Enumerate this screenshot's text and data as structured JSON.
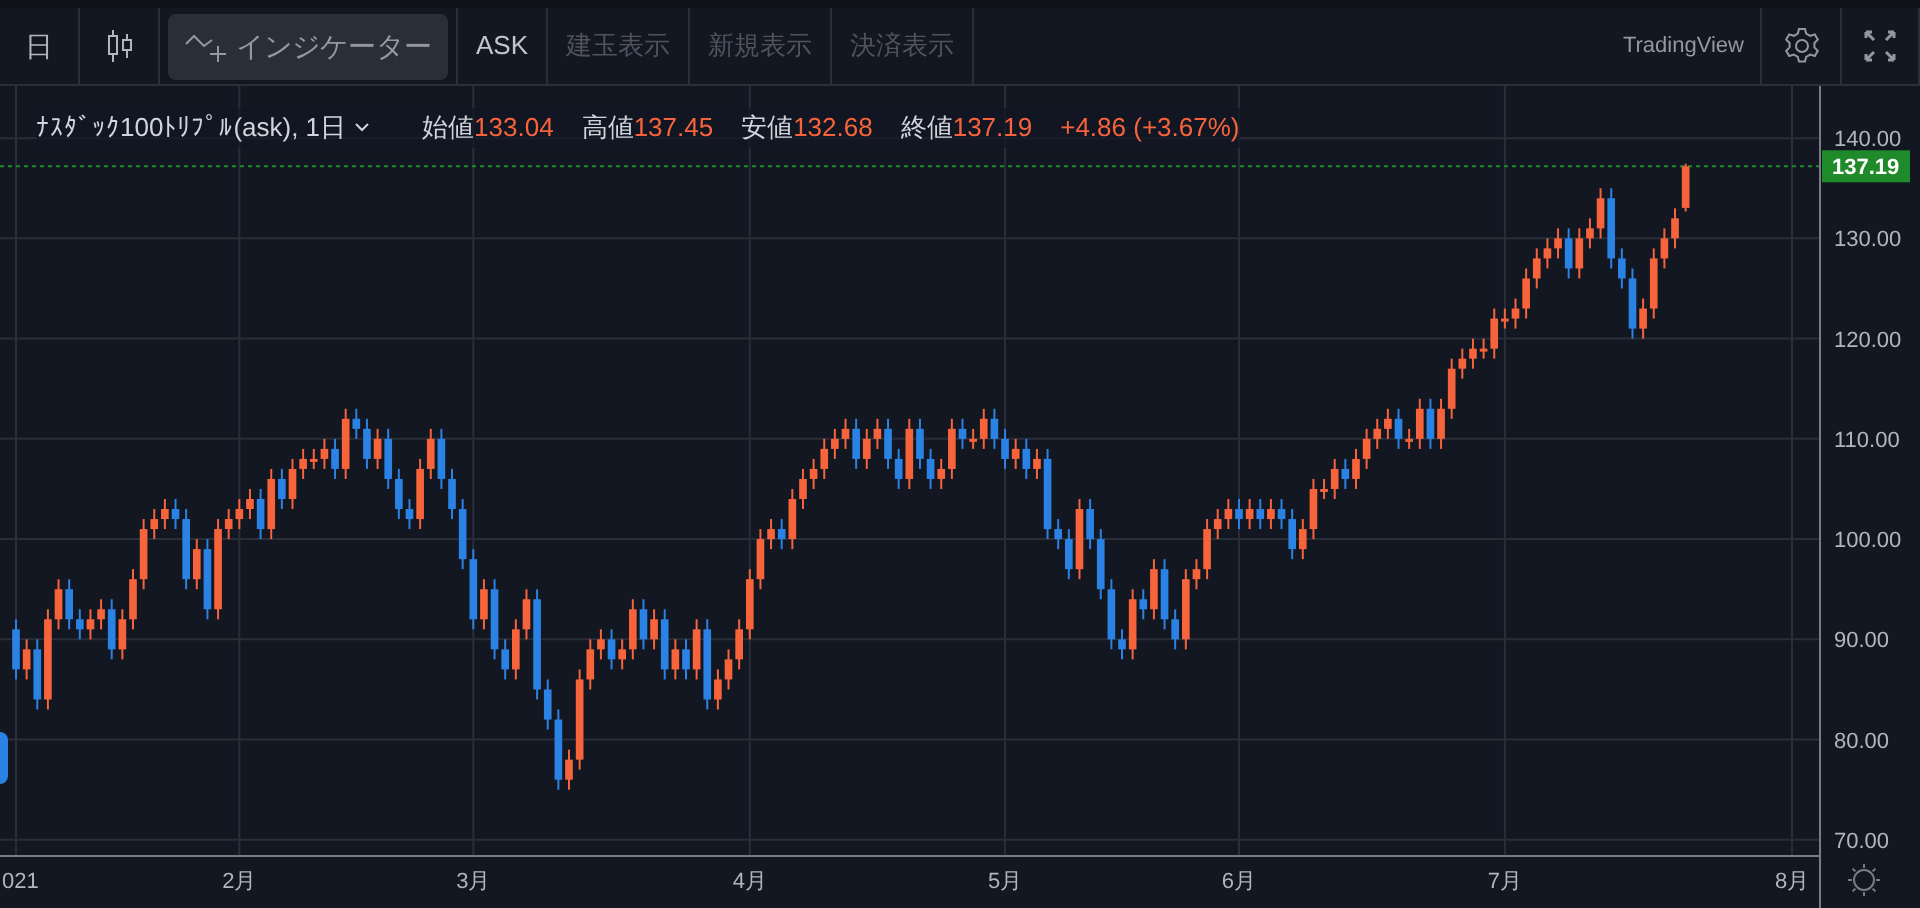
{
  "toolbar": {
    "interval": "日",
    "indicator_button": "インジケーター",
    "buttons": [
      {
        "label": "ASK",
        "disabled": false
      },
      {
        "label": "建玉表示",
        "disabled": true
      },
      {
        "label": "新規表示",
        "disabled": true
      },
      {
        "label": "決済表示",
        "disabled": true
      }
    ],
    "brand": "TradingView"
  },
  "legend": {
    "symbol": "ﾅｽﾀﾞｯｸ100ﾄﾘﾌﾟﾙ(ask), 1日",
    "fields": [
      {
        "label": "始値",
        "value": "133.04"
      },
      {
        "label": "高値",
        "value": "137.45"
      },
      {
        "label": "安値",
        "value": "132.68"
      },
      {
        "label": "終値",
        "value": "137.19"
      }
    ],
    "change": "+4.86 (+3.67%)"
  },
  "chart": {
    "chart_data": {
      "type": "candlestick",
      "ylim": [
        63.2,
        145.2
      ],
      "grid": true,
      "yticks": [
        {
          "value": 70,
          "label": "70.00"
        },
        {
          "value": 80,
          "label": "80.00"
        },
        {
          "value": 90,
          "label": "90.00"
        },
        {
          "value": 100,
          "label": "100.00"
        },
        {
          "value": 110,
          "label": "110.00"
        },
        {
          "value": 120,
          "label": "120.00"
        },
        {
          "value": 130,
          "label": "130.00"
        },
        {
          "value": 140,
          "label": "140.00"
        }
      ],
      "categories": [
        "021",
        null,
        null,
        null,
        null,
        null,
        null,
        null,
        null,
        null,
        null,
        null,
        null,
        null,
        null,
        null,
        null,
        null,
        null,
        null,
        null,
        "2月",
        null,
        null,
        null,
        null,
        null,
        null,
        null,
        null,
        null,
        null,
        null,
        null,
        null,
        null,
        null,
        null,
        null,
        null,
        null,
        null,
        null,
        "3月",
        null,
        null,
        null,
        null,
        null,
        null,
        null,
        null,
        null,
        null,
        null,
        null,
        null,
        null,
        null,
        null,
        null,
        null,
        null,
        null,
        null,
        null,
        null,
        null,
        null,
        "4月",
        null,
        null,
        null,
        null,
        null,
        null,
        null,
        null,
        null,
        null,
        null,
        null,
        null,
        null,
        null,
        null,
        null,
        null,
        null,
        null,
        null,
        null,
        null,
        "5月",
        null,
        null,
        null,
        null,
        null,
        null,
        null,
        null,
        null,
        null,
        null,
        null,
        null,
        null,
        null,
        null,
        null,
        null,
        null,
        null,
        null,
        "6月",
        null,
        null,
        null,
        null,
        null,
        null,
        null,
        null,
        null,
        null,
        null,
        null,
        null,
        null,
        null,
        null,
        null,
        null,
        null,
        null,
        null,
        null,
        null,
        null,
        "7月",
        null,
        null,
        null,
        null,
        null,
        null,
        null,
        null,
        null,
        null,
        null,
        null,
        null,
        null,
        null,
        null,
        null,
        null,
        null,
        null,
        null,
        null,
        null,
        null,
        null,
        null,
        "8月"
      ],
      "ref_lines": [
        {
          "axis": "y",
          "value": 137.19,
          "color": "#1f8a2a",
          "label": "137.19"
        }
      ],
      "ohlc": [
        [
          91,
          92,
          86,
          87
        ],
        [
          87,
          90,
          86,
          89
        ],
        [
          89,
          90,
          83,
          84
        ],
        [
          84,
          93,
          83,
          92
        ],
        [
          92,
          96,
          91,
          95
        ],
        [
          95,
          96,
          91,
          92
        ],
        [
          92,
          93,
          90,
          91
        ],
        [
          91,
          93,
          90,
          92
        ],
        [
          92,
          94,
          91,
          93
        ],
        [
          93,
          94,
          88,
          89
        ],
        [
          89,
          93,
          88,
          92
        ],
        [
          92,
          97,
          91,
          96
        ],
        [
          96,
          102,
          95,
          101
        ],
        [
          101,
          103,
          100,
          102
        ],
        [
          102,
          104,
          101,
          103
        ],
        [
          103,
          104,
          101,
          102
        ],
        [
          102,
          103,
          95,
          96
        ],
        [
          96,
          100,
          95,
          99
        ],
        [
          99,
          100,
          92,
          93
        ],
        [
          93,
          102,
          92,
          101
        ],
        [
          101,
          103,
          100,
          102
        ],
        [
          102,
          104,
          101,
          103
        ],
        [
          103,
          105,
          102,
          104
        ],
        [
          104,
          105,
          100,
          101
        ],
        [
          101,
          107,
          100,
          106
        ],
        [
          106,
          107,
          103,
          104
        ],
        [
          104,
          108,
          103,
          107
        ],
        [
          107,
          109,
          106,
          108
        ],
        [
          108,
          109,
          107,
          108
        ],
        [
          108,
          110,
          107,
          109
        ],
        [
          109,
          110,
          106,
          107
        ],
        [
          107,
          113,
          106,
          112
        ],
        [
          112,
          113,
          110,
          111
        ],
        [
          111,
          112,
          107,
          108
        ],
        [
          108,
          111,
          107,
          110
        ],
        [
          110,
          111,
          105,
          106
        ],
        [
          106,
          107,
          102,
          103
        ],
        [
          103,
          104,
          101,
          102
        ],
        [
          102,
          108,
          101,
          107
        ],
        [
          107,
          111,
          106,
          110
        ],
        [
          110,
          111,
          105,
          106
        ],
        [
          106,
          107,
          102,
          103
        ],
        [
          103,
          104,
          97,
          98
        ],
        [
          98,
          99,
          91,
          92
        ],
        [
          92,
          96,
          91,
          95
        ],
        [
          95,
          96,
          88,
          89
        ],
        [
          89,
          90,
          86,
          87
        ],
        [
          87,
          92,
          86,
          91
        ],
        [
          91,
          95,
          90,
          94
        ],
        [
          94,
          95,
          84,
          85
        ],
        [
          85,
          86,
          81,
          82
        ],
        [
          82,
          83,
          75,
          76
        ],
        [
          76,
          79,
          75,
          78
        ],
        [
          78,
          87,
          77,
          86
        ],
        [
          86,
          90,
          85,
          89
        ],
        [
          89,
          91,
          88,
          90
        ],
        [
          90,
          91,
          87,
          88
        ],
        [
          88,
          90,
          87,
          89
        ],
        [
          89,
          94,
          88,
          93
        ],
        [
          93,
          94,
          89,
          90
        ],
        [
          90,
          93,
          89,
          92
        ],
        [
          92,
          93,
          86,
          87
        ],
        [
          87,
          90,
          86,
          89
        ],
        [
          89,
          90,
          86,
          87
        ],
        [
          87,
          92,
          86,
          91
        ],
        [
          91,
          92,
          83,
          84
        ],
        [
          84,
          87,
          83,
          86
        ],
        [
          86,
          89,
          85,
          88
        ],
        [
          88,
          92,
          87,
          91
        ],
        [
          91,
          97,
          90,
          96
        ],
        [
          96,
          101,
          95,
          100
        ],
        [
          100,
          102,
          99,
          101
        ],
        [
          101,
          102,
          99,
          100
        ],
        [
          100,
          105,
          99,
          104
        ],
        [
          104,
          107,
          103,
          106
        ],
        [
          106,
          108,
          105,
          107
        ],
        [
          107,
          110,
          106,
          109
        ],
        [
          109,
          111,
          108,
          110
        ],
        [
          110,
          112,
          109,
          111
        ],
        [
          111,
          112,
          107,
          108
        ],
        [
          108,
          111,
          107,
          110
        ],
        [
          110,
          112,
          109,
          111
        ],
        [
          111,
          112,
          107,
          108
        ],
        [
          108,
          109,
          105,
          106
        ],
        [
          106,
          112,
          105,
          111
        ],
        [
          111,
          112,
          107,
          108
        ],
        [
          108,
          109,
          105,
          106
        ],
        [
          106,
          108,
          105,
          107
        ],
        [
          107,
          112,
          106,
          111
        ],
        [
          111,
          112,
          109,
          110
        ],
        [
          110,
          111,
          109,
          110
        ],
        [
          110,
          113,
          109,
          112
        ],
        [
          112,
          113,
          109,
          110
        ],
        [
          110,
          111,
          107,
          108
        ],
        [
          108,
          110,
          107,
          109
        ],
        [
          109,
          110,
          106,
          107
        ],
        [
          107,
          109,
          106,
          108
        ],
        [
          108,
          109,
          100,
          101
        ],
        [
          101,
          102,
          99,
          100
        ],
        [
          100,
          101,
          96,
          97
        ],
        [
          97,
          104,
          96,
          103
        ],
        [
          103,
          104,
          99,
          100
        ],
        [
          100,
          101,
          94,
          95
        ],
        [
          95,
          96,
          89,
          90
        ],
        [
          90,
          91,
          88,
          89
        ],
        [
          89,
          95,
          88,
          94
        ],
        [
          94,
          95,
          92,
          93
        ],
        [
          93,
          98,
          92,
          97
        ],
        [
          97,
          98,
          91,
          92
        ],
        [
          92,
          93,
          89,
          90
        ],
        [
          90,
          97,
          89,
          96
        ],
        [
          96,
          98,
          95,
          97
        ],
        [
          97,
          102,
          96,
          101
        ],
        [
          101,
          103,
          100,
          102
        ],
        [
          102,
          104,
          101,
          103
        ],
        [
          103,
          104,
          101,
          102
        ],
        [
          102,
          104,
          101,
          103
        ],
        [
          103,
          104,
          101,
          102
        ],
        [
          102,
          104,
          101,
          103
        ],
        [
          103,
          104,
          101,
          102
        ],
        [
          102,
          103,
          98,
          99
        ],
        [
          99,
          102,
          98,
          101
        ],
        [
          101,
          106,
          100,
          105
        ],
        [
          105,
          106,
          104,
          105
        ],
        [
          105,
          108,
          104,
          107
        ],
        [
          107,
          108,
          105,
          106
        ],
        [
          106,
          109,
          105,
          108
        ],
        [
          108,
          111,
          107,
          110
        ],
        [
          110,
          112,
          109,
          111
        ],
        [
          111,
          113,
          110,
          112
        ],
        [
          112,
          113,
          109,
          110
        ],
        [
          110,
          111,
          109,
          110
        ],
        [
          110,
          114,
          109,
          113
        ],
        [
          113,
          114,
          109,
          110
        ],
        [
          110,
          114,
          109,
          113
        ],
        [
          113,
          118,
          112,
          117
        ],
        [
          117,
          119,
          116,
          118
        ],
        [
          118,
          120,
          117,
          119
        ],
        [
          119,
          120,
          118,
          119
        ],
        [
          119,
          123,
          118,
          122
        ],
        [
          122,
          123,
          121,
          122
        ],
        [
          122,
          124,
          121,
          123
        ],
        [
          123,
          127,
          122,
          126
        ],
        [
          126,
          129,
          125,
          128
        ],
        [
          128,
          130,
          127,
          129
        ],
        [
          129,
          131,
          128,
          130
        ],
        [
          130,
          131,
          126,
          127
        ],
        [
          127,
          131,
          126,
          130
        ],
        [
          130,
          132,
          129,
          131
        ],
        [
          131,
          135,
          130,
          134
        ],
        [
          134,
          135,
          127,
          128
        ],
        [
          128,
          129,
          125,
          126
        ],
        [
          126,
          127,
          120,
          121
        ],
        [
          121,
          124,
          120,
          123
        ],
        [
          123,
          129,
          122,
          128
        ],
        [
          128,
          131,
          127,
          130
        ],
        [
          130,
          133,
          129,
          132
        ],
        [
          133.04,
          137.45,
          132.68,
          137.19
        ],
        null,
        null,
        null,
        null,
        null,
        null,
        null,
        null,
        null,
        null
      ]
    }
  }
}
